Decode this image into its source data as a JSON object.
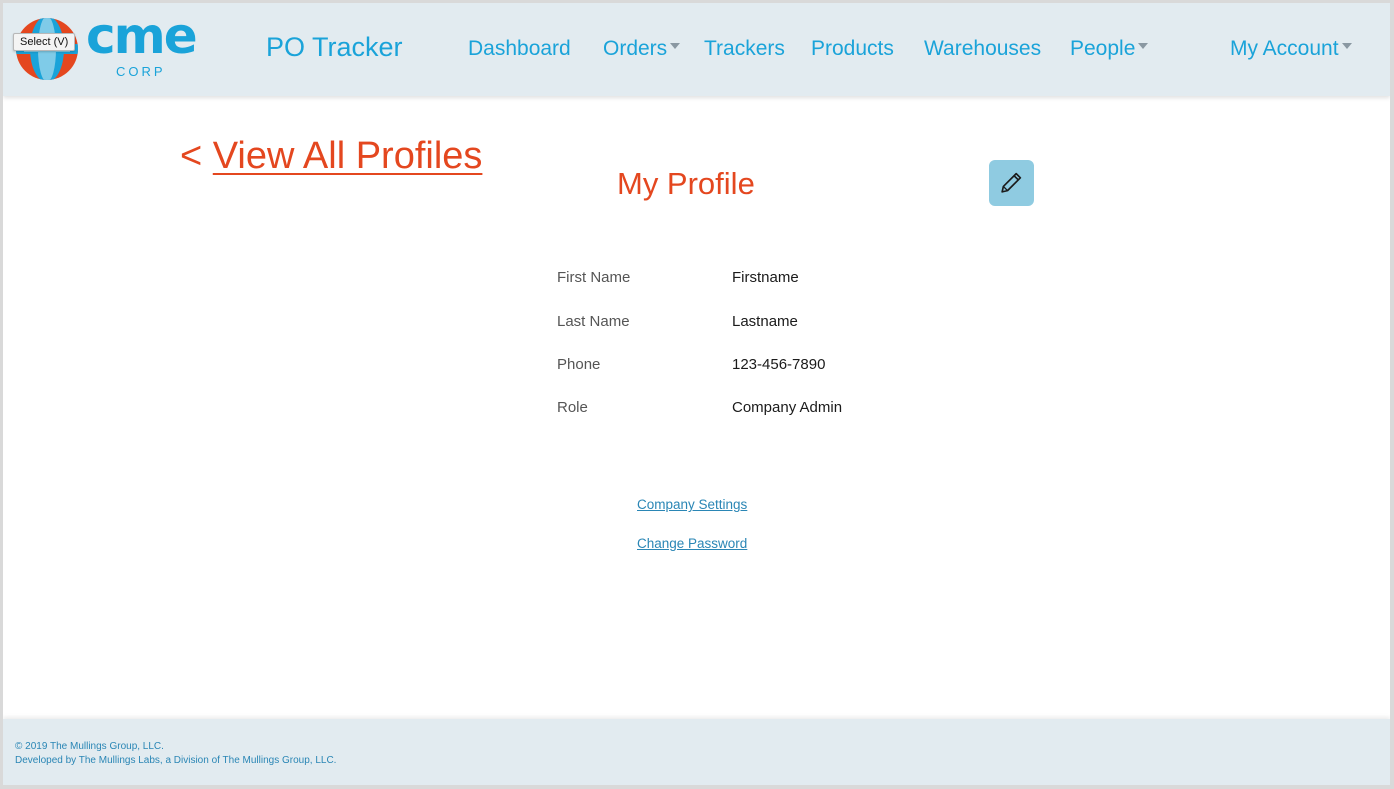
{
  "header": {
    "logo_text": "cme",
    "logo_subtext": "CORP",
    "tooltip": "Select (V)",
    "app_title": "PO Tracker",
    "nav": {
      "dashboard": "Dashboard",
      "orders": "Orders",
      "trackers": "Trackers",
      "products": "Products",
      "warehouses": "Warehouses",
      "people": "People",
      "my_account": "My Account"
    }
  },
  "main": {
    "back_arrow": "<",
    "back_link": "View All Profiles",
    "title": "My Profile",
    "edit_icon": "pencil-icon",
    "fields": [
      {
        "label": "First Name",
        "value": "Firstname"
      },
      {
        "label": "Last Name",
        "value": "Lastname"
      },
      {
        "label": "Phone",
        "value": "123-456-7890"
      },
      {
        "label": "Role",
        "value": "Company Admin"
      }
    ],
    "links": {
      "company_settings": "Company Settings",
      "change_password": "Change Password"
    }
  },
  "footer": {
    "copyright": "© 2019 The Mullings Group, LLC.",
    "developed_by": "Developed by The Mullings Labs, a Division of The Mullings Group, LLC."
  },
  "colors": {
    "brand_blue": "#1aa3d9",
    "accent_orange": "#e4471f",
    "header_bg": "#e2ebf0",
    "edit_button_bg": "#8fcbe1",
    "link_blue": "#2a86b5"
  }
}
